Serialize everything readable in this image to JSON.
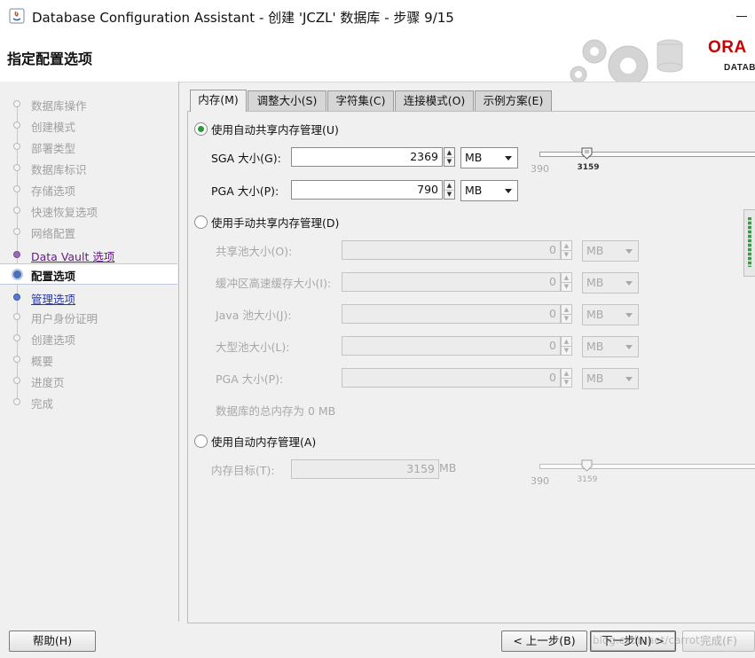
{
  "window": {
    "title": "Database Configuration Assistant - 创建 'JCZL' 数据库 - 步骤 9/15"
  },
  "header": {
    "heading": "指定配置选项",
    "logo_text": "ORA",
    "logo_sub": "DATAB"
  },
  "sidebar": {
    "steps": [
      {
        "label": "数据库操作",
        "state": "disabled"
      },
      {
        "label": "创建模式",
        "state": "disabled"
      },
      {
        "label": "部署类型",
        "state": "disabled"
      },
      {
        "label": "数据库标识",
        "state": "disabled"
      },
      {
        "label": "存储选项",
        "state": "disabled"
      },
      {
        "label": "快速恢复选项",
        "state": "disabled"
      },
      {
        "label": "网络配置",
        "state": "disabled"
      },
      {
        "label": "Data Vault 选项",
        "state": "visited"
      },
      {
        "label": "配置选项",
        "state": "current"
      },
      {
        "label": "管理选项",
        "state": "link"
      },
      {
        "label": "用户身份证明",
        "state": "disabled"
      },
      {
        "label": "创建选项",
        "state": "disabled"
      },
      {
        "label": "概要",
        "state": "disabled"
      },
      {
        "label": "进度页",
        "state": "disabled"
      },
      {
        "label": "完成",
        "state": "disabled"
      }
    ]
  },
  "tabs": [
    {
      "label": "内存(M)",
      "active": true
    },
    {
      "label": "调整大小(S)",
      "active": false
    },
    {
      "label": "字符集(C)",
      "active": false
    },
    {
      "label": "连接模式(O)",
      "active": false
    },
    {
      "label": "示例方案(E)",
      "active": false
    }
  ],
  "memory": {
    "asmm": {
      "radio_label": "使用自动共享内存管理(U)",
      "selected": true,
      "sga_label": "SGA 大小(G):",
      "sga_value": "2369",
      "sga_unit": "MB",
      "pga_label": "PGA 大小(P):",
      "pga_value": "790",
      "pga_unit": "MB",
      "slider_min": "390",
      "slider_value": "3159",
      "slider_level": 0.22
    },
    "manual": {
      "radio_label": "使用手动共享内存管理(D)",
      "selected": false,
      "shared_pool_label": "共享池大小(O):",
      "shared_pool_value": "0",
      "buffer_cache_label": "缓冲区高速缓存大小(I):",
      "buffer_cache_value": "0",
      "java_pool_label": "Java 池大小(J):",
      "java_pool_value": "0",
      "large_pool_label": "大型池大小(L):",
      "large_pool_value": "0",
      "pga_label": "PGA 大小(P):",
      "pga_value": "0",
      "unit": "MB",
      "total_text": "数据库的总内存为 0 MB"
    },
    "amm": {
      "radio_label": "使用自动内存管理(A)",
      "selected": false,
      "target_label": "内存目标(T):",
      "target_value": "3159",
      "target_unit": "MB",
      "slider_min": "390",
      "slider_value": "3159",
      "slider_level": 0.22
    }
  },
  "buttons": {
    "help": "帮助(H)",
    "back": "< 上一步(B)",
    "next": "下一步(N) >",
    "finish": "完成(F)"
  },
  "watermark": "blog.csdn.net/carrot"
}
